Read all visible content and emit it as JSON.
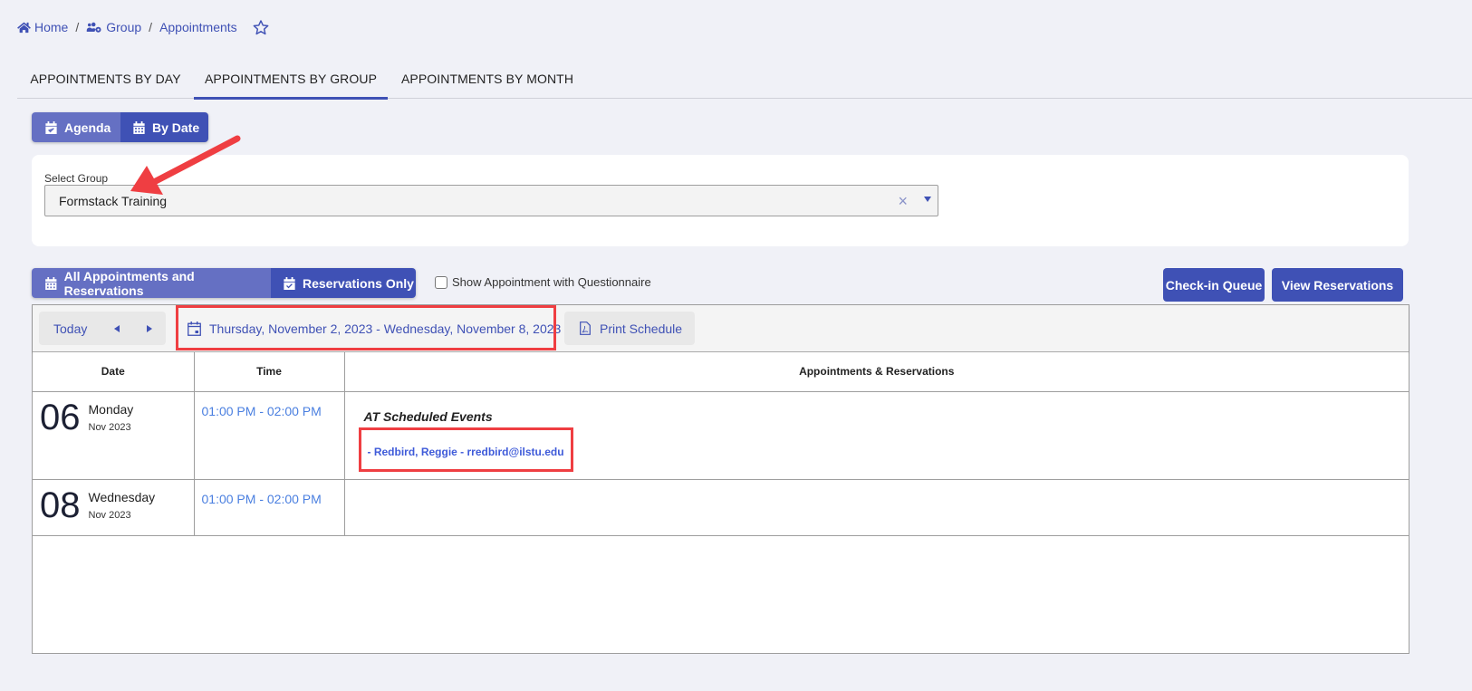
{
  "breadcrumb": {
    "items": [
      {
        "label": "Home",
        "icon": "home-icon"
      },
      {
        "label": "Group",
        "icon": "users-gear-icon"
      },
      {
        "label": "Appointments"
      }
    ],
    "separator": "/",
    "favorite_icon": "star-icon"
  },
  "tabs": [
    {
      "label": "APPOINTMENTS BY DAY",
      "active": false
    },
    {
      "label": "APPOINTMENTS BY GROUP",
      "active": true
    },
    {
      "label": "APPOINTMENTS BY MONTH",
      "active": false
    }
  ],
  "view_toggle": {
    "agenda_label": "Agenda",
    "by_date_label": "By Date",
    "selected": "By Date"
  },
  "select_group": {
    "label": "Select Group",
    "value": "Formstack Training",
    "clear_symbol": "×"
  },
  "filter_toggle": {
    "all_label": "All Appointments and Reservations",
    "reservations_label": "Reservations Only",
    "selected": "Reservations Only"
  },
  "questionnaire_checkbox": {
    "label": "Show Appointment with Questionnaire",
    "checked": false
  },
  "actions": {
    "checkin_label": "Check-in Queue",
    "view_reservations_label": "View Reservations"
  },
  "toolbar": {
    "today_label": "Today",
    "date_range": "Thursday, November 2, 2023 - Wednesday, November 8, 2023",
    "print_label": "Print Schedule"
  },
  "table": {
    "headers": [
      "Date",
      "Time",
      "Appointments & Reservations"
    ],
    "rows": [
      {
        "day": "06",
        "weekday": "Monday",
        "month_year": "Nov 2023",
        "time": "01:00 PM - 02:00 PM",
        "event_title": "AT Scheduled Events",
        "items": [
          "-  Redbird, Reggie - rredbird@ilstu.edu"
        ]
      },
      {
        "day": "08",
        "weekday": "Wednesday",
        "month_year": "Nov 2023",
        "time": "01:00 PM - 02:00 PM",
        "event_title": "",
        "items": []
      }
    ]
  },
  "colors": {
    "primary": "#3f51b5",
    "primary_light": "#6570c3",
    "annotation_red": "#ef3e42",
    "time_blue": "#4a7fe0",
    "background": "#f0f1f7"
  }
}
